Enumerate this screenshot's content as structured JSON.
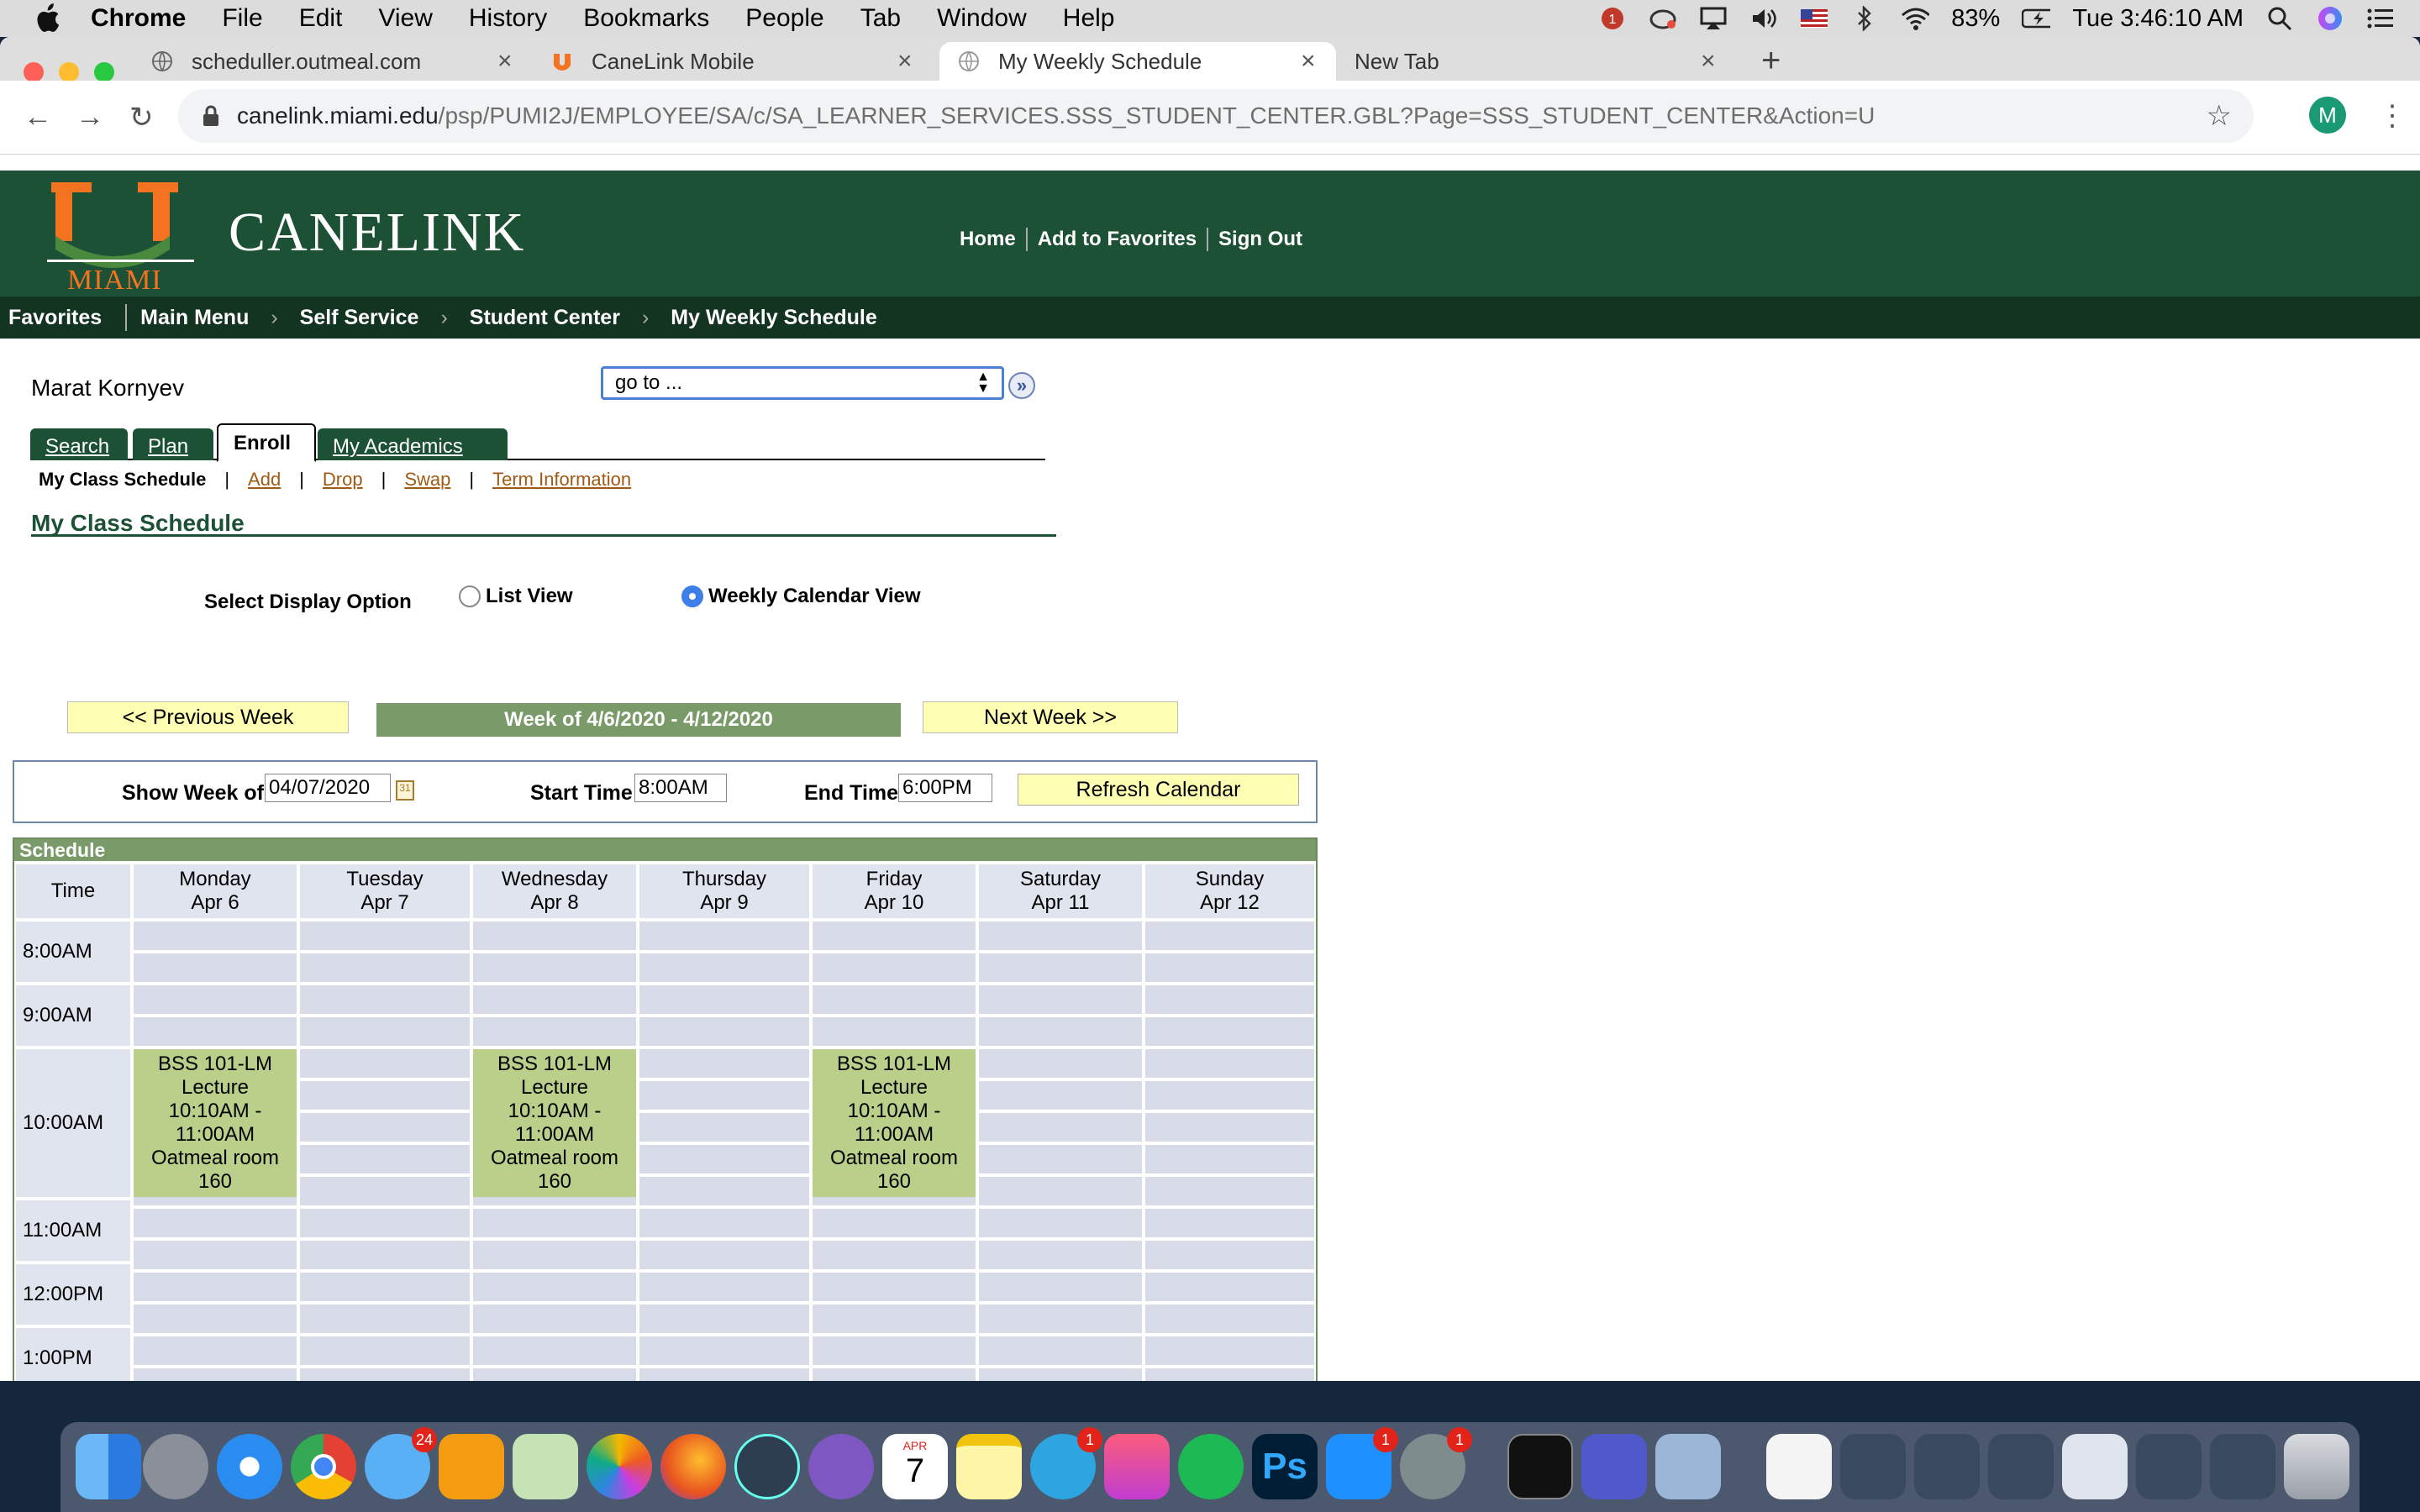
{
  "menubar": {
    "app_name": "Chrome",
    "items": [
      "File",
      "Edit",
      "View",
      "History",
      "Bookmarks",
      "People",
      "Tab",
      "Window",
      "Help"
    ],
    "battery": "83%",
    "clock": "Tue 3:46:10 AM"
  },
  "browser": {
    "tabs": [
      {
        "title": "scheduller.outmeal.com"
      },
      {
        "title": "CaneLink Mobile"
      },
      {
        "title": "My Weekly Schedule"
      },
      {
        "title": "New Tab"
      }
    ],
    "url_host": "canelink.miami.edu",
    "url_path": "/psp/PUMI2J/EMPLOYEE/SA/c/SA_LEARNER_SERVICES.SSS_STUDENT_CENTER.GBL?Page=SSS_STUDENT_CENTER&Action=U",
    "profile_initial": "M"
  },
  "header": {
    "logo_text": "MIAMI",
    "brand": "CANELINK",
    "links": [
      "Home",
      "Add to Favorites",
      "Sign Out"
    ]
  },
  "breadcrumb": {
    "favorites": "Favorites",
    "items": [
      "Main Menu",
      "Self Service",
      "Student Center",
      "My Weekly Schedule"
    ]
  },
  "student": {
    "name": "Marat Kornyev"
  },
  "goto": {
    "value": "go to ..."
  },
  "tabs": [
    "Search",
    "Plan",
    "Enroll",
    "My Academics"
  ],
  "subnav": {
    "current": "My Class Schedule",
    "links": [
      "Add",
      "Drop",
      "Swap",
      "Term Information"
    ]
  },
  "page_title": "My Class Schedule",
  "display_option": {
    "label": "Select Display Option",
    "list_view": "List View",
    "calendar_view": "Weekly Calendar View",
    "selected": "Weekly Calendar View"
  },
  "week_nav": {
    "prev": "<< Previous Week",
    "label": "Week of 4/6/2020 - 4/12/2020",
    "next": "Next Week >>"
  },
  "controls": {
    "show_week_label": "Show Week of",
    "show_week_value": "04/07/2020",
    "start_label": "Start Time",
    "start_value": "8:00AM",
    "end_label": "End Time",
    "end_value": "6:00PM",
    "refresh": "Refresh Calendar"
  },
  "schedule": {
    "title": "Schedule",
    "time_header": "Time",
    "days": [
      {
        "day": "Monday",
        "date": "Apr 6"
      },
      {
        "day": "Tuesday",
        "date": "Apr 7"
      },
      {
        "day": "Wednesday",
        "date": "Apr 8"
      },
      {
        "day": "Thursday",
        "date": "Apr 9"
      },
      {
        "day": "Friday",
        "date": "Apr 10"
      },
      {
        "day": "Saturday",
        "date": "Apr 11"
      },
      {
        "day": "Sunday",
        "date": "Apr 12"
      }
    ],
    "times": [
      "8:00AM",
      "9:00AM",
      "10:00AM",
      "11:00AM",
      "12:00PM",
      "1:00PM"
    ],
    "event": {
      "course": "BSS 101-LM",
      "type": "Lecture",
      "time": "10:10AM - 11:00AM",
      "location": "Oatmeal room 160",
      "days": [
        "Monday",
        "Wednesday",
        "Friday"
      ]
    }
  },
  "dock": {
    "badges": {
      "messages": "24",
      "telegram": "1",
      "appstore": "1",
      "prefs": "1",
      "calendar_month": "APR",
      "calendar_day": "7",
      "chrome_notif": "1"
    }
  }
}
